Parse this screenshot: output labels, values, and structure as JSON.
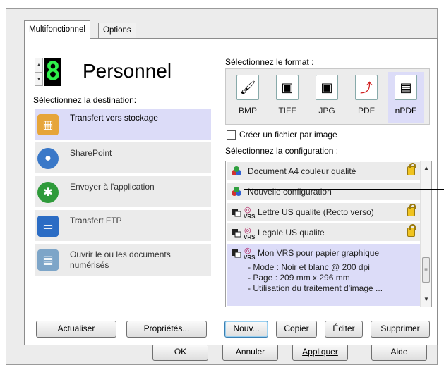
{
  "tabs": {
    "main": "Multifonctionnel",
    "options": "Options"
  },
  "profile": {
    "digit": "8",
    "name": "Personnel"
  },
  "destination": {
    "label": "Sélectionnez la destination:",
    "items": [
      {
        "label": "Transfert vers stockage",
        "icon": "storage-transfer-icon",
        "selected": true
      },
      {
        "label": "SharePoint",
        "icon": "sharepoint-icon",
        "selected": false
      },
      {
        "label": "Envoyer à l'application",
        "icon": "send-to-app-icon",
        "selected": false
      },
      {
        "label": "Transfert FTP",
        "icon": "ftp-icon",
        "selected": false
      },
      {
        "label": "Ouvrir le ou les documents numérisés",
        "icon": "open-document-icon",
        "selected": false
      }
    ]
  },
  "format": {
    "label": "Sélectionnez le format :",
    "items": [
      {
        "label": "BMP",
        "icon": "bmp-icon",
        "selected": false
      },
      {
        "label": "TIFF",
        "icon": "tiff-icon",
        "selected": false
      },
      {
        "label": "JPG",
        "icon": "jpg-icon",
        "selected": false
      },
      {
        "label": "PDF",
        "icon": "pdf-icon",
        "selected": false
      },
      {
        "label": "nPDF",
        "icon": "npdf-icon",
        "selected": true
      }
    ],
    "checkbox_label": "Créer un fichier par image",
    "checkbox_checked": false
  },
  "configuration": {
    "label": "Sélectionnez la configuration :",
    "items": [
      {
        "name": "Document A4 couleur qualité",
        "vrs": false,
        "locked": true
      },
      {
        "name": "Nouvelle configuration",
        "vrs": false,
        "locked": false
      },
      {
        "name": "Lettre US qualite (Recto verso)",
        "vrs": true,
        "locked": true
      },
      {
        "name": "Legale US qualite",
        "vrs": true,
        "locked": true
      },
      {
        "name": "Mon VRS pour papier graphique",
        "vrs": true,
        "locked": false,
        "selected": true,
        "details": [
          "- Mode : Noir et blanc @ 200 dpi",
          "- Page : 209 mm x 296 mm",
          "- Utilisation du traitement d'image ..."
        ]
      }
    ],
    "vrs_badge": "VRS"
  },
  "buttons": {
    "refresh": "Actualiser",
    "properties": "Propriétés...",
    "new": "Nouv...",
    "copy": "Copier",
    "edit": "Éditer",
    "delete": "Supprimer",
    "ok": "OK",
    "cancel": "Annuler",
    "apply": "Appliquer",
    "help": "Aide"
  },
  "colors": {
    "selection": "#dcdcf8",
    "lcd_digit": "#2ef04a",
    "lock": "#f0c420"
  }
}
